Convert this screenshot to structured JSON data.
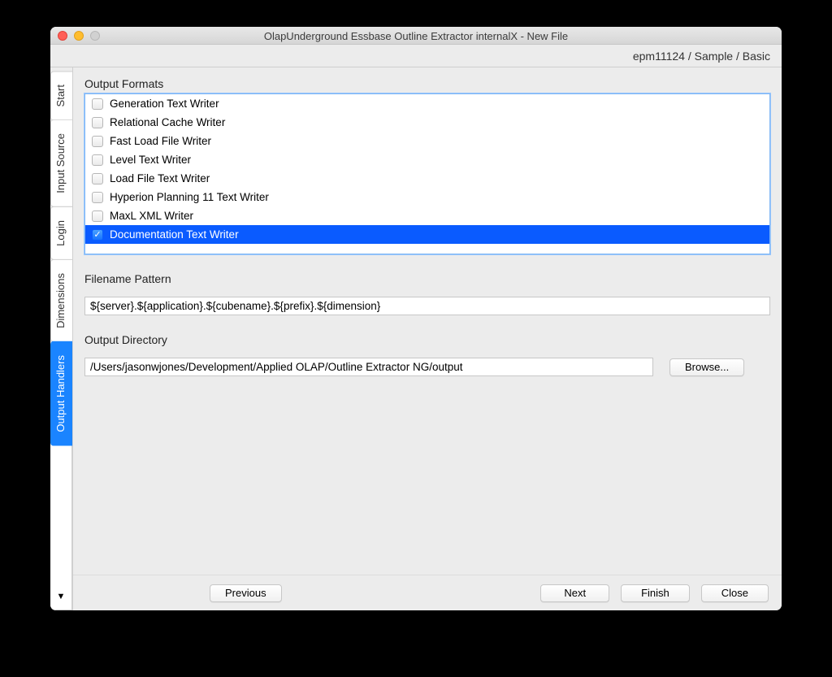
{
  "window": {
    "title": "OlapUnderground Essbase Outline Extractor internalX - New File"
  },
  "breadcrumb": "epm11124 / Sample / Basic",
  "tabs": [
    {
      "label": "Start",
      "active": false
    },
    {
      "label": "Input Source",
      "active": false
    },
    {
      "label": "Login",
      "active": false
    },
    {
      "label": "Dimensions",
      "active": false
    },
    {
      "label": "Output Handlers",
      "active": true
    }
  ],
  "sections": {
    "output_formats_label": "Output Formats",
    "filename_pattern_label": "Filename Pattern",
    "output_directory_label": "Output Directory"
  },
  "output_formats": [
    {
      "label": "Generation Text Writer",
      "checked": false,
      "selected": false
    },
    {
      "label": "Relational Cache Writer",
      "checked": false,
      "selected": false
    },
    {
      "label": "Fast Load File Writer",
      "checked": false,
      "selected": false
    },
    {
      "label": "Level Text Writer",
      "checked": false,
      "selected": false
    },
    {
      "label": "Load File Text Writer",
      "checked": false,
      "selected": false
    },
    {
      "label": "Hyperion Planning 11 Text Writer",
      "checked": false,
      "selected": false
    },
    {
      "label": "MaxL XML Writer",
      "checked": false,
      "selected": false
    },
    {
      "label": "Documentation Text Writer",
      "checked": true,
      "selected": true
    }
  ],
  "filename_pattern": "${server}.${application}.${cubename}.${prefix}.${dimension}",
  "output_directory": "/Users/jasonwjones/Development/Applied OLAP/Outline Extractor NG/output",
  "buttons": {
    "browse": "Browse...",
    "previous": "Previous",
    "next": "Next",
    "finish": "Finish",
    "close": "Close"
  }
}
